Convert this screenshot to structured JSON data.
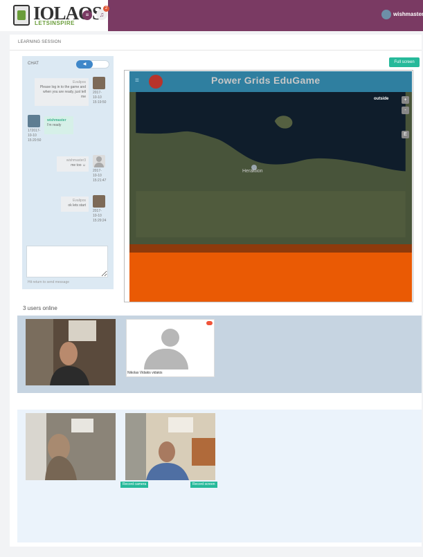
{
  "header": {
    "logo_text": "IOLAOS",
    "logo_sub": "LETSINSPIRE",
    "notification_count": "2",
    "username": "wishmaster"
  },
  "page": {
    "heading": "LEARNING SESSION"
  },
  "chat": {
    "title": "CHAT",
    "messages": [
      {
        "author": "Evalipos",
        "text": "Please log in to the game and when you are ready, just tell me",
        "time_1": "2017-",
        "time_2": "10-10",
        "time_3": "15:19:50"
      },
      {
        "author": "wishmaster",
        "text": "I'm ready",
        "time_1": "172017-",
        "time_2": "10-10",
        "time_3": "15:20:50"
      },
      {
        "author": "wishmaster3",
        "text": "me too ☺",
        "time_1": "2017-",
        "time_2": "10-10",
        "time_3": "15:21:47"
      },
      {
        "author": "Evalipos",
        "text": "ok lets start",
        "time_1": "2017-",
        "time_2": "10-10",
        "time_3": "15:29:24"
      }
    ],
    "input_hint": "Hit return to send message"
  },
  "game": {
    "fullscreen_label": "Full screen",
    "title": "Power Grids EduGame",
    "outside_label": "outside",
    "zoom_in": "+",
    "zoom_out": "-",
    "e_button": "E",
    "city": "Heraklion"
  },
  "session": {
    "users_online": "3 users online",
    "user_card_name": "Nikolas Vidakis vidakis",
    "record_camera": "Record camera",
    "record_screen": "Record screen"
  },
  "colors": {
    "topbar": "#7a3a63",
    "accent": "#26b99a",
    "game_header": "#2f7fa0",
    "game_orange": "#ea5a04"
  }
}
